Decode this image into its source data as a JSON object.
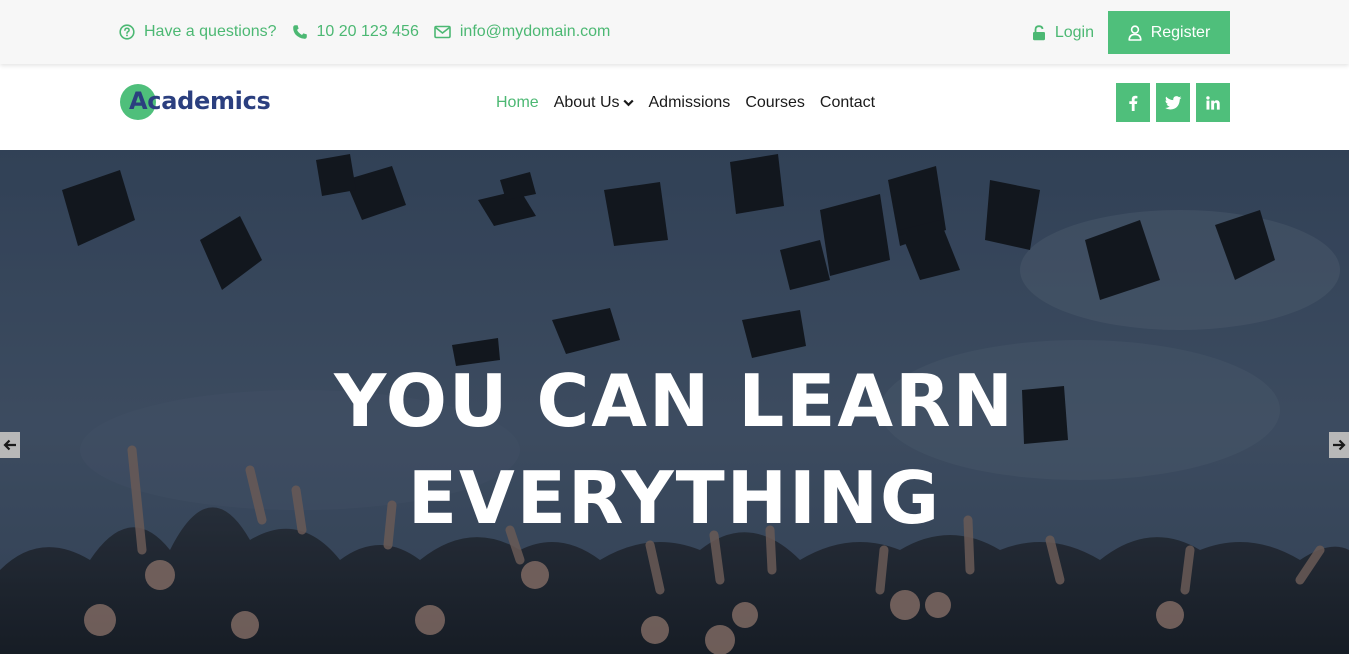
{
  "topbar": {
    "question_text": "Have a questions?",
    "phone": "10 20 123 456",
    "email": "info@mydomain.com",
    "login_label": "Login",
    "register_label": "Register",
    "icons": [
      "question-circle-icon",
      "phone-icon",
      "envelope-icon",
      "lock-icon",
      "user-icon"
    ]
  },
  "brand": {
    "name": "Academics"
  },
  "nav": {
    "items": [
      {
        "label": "Home",
        "active": true
      },
      {
        "label": "About Us",
        "has_dropdown": true
      },
      {
        "label": "Admissions"
      },
      {
        "label": "Courses"
      },
      {
        "label": "Contact"
      }
    ]
  },
  "social": [
    "facebook-icon",
    "twitter-icon",
    "linkedin-icon"
  ],
  "hero": {
    "headline_line1": "YOU CAN LEARN",
    "headline_line2": "EVERYTHING"
  },
  "colors": {
    "accent": "#4fbf7b",
    "accent_text": "#4cb873",
    "brand_text": "#2b3f7f",
    "hero_overlay": "#2f3f55"
  }
}
